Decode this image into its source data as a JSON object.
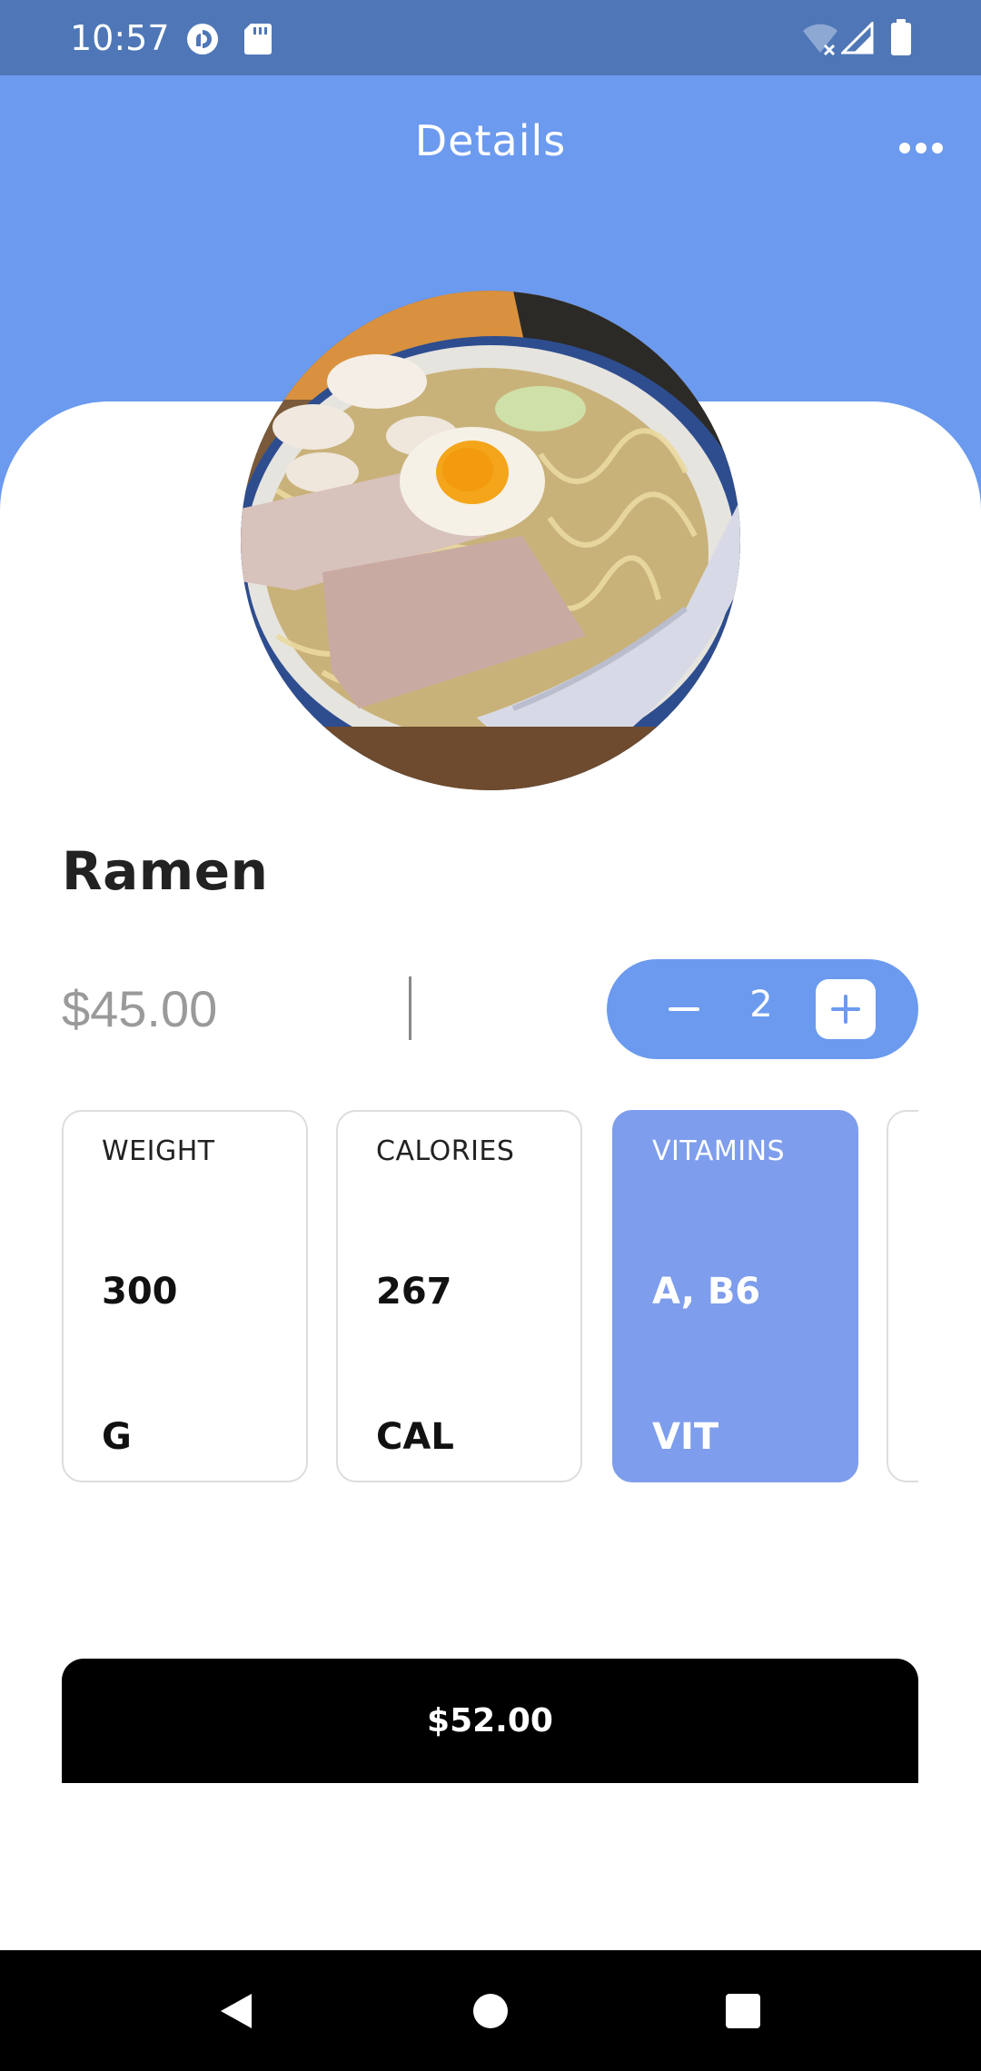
{
  "status_bar": {
    "time": "10:57",
    "icons": [
      "pocket-casts-icon",
      "sd-card-icon",
      "wifi-off-icon",
      "signal-icon",
      "battery-icon"
    ]
  },
  "app_bar": {
    "title": "Details",
    "menu_icon": "more-horizontal-icon"
  },
  "dish": {
    "name": "Ramen",
    "price": "$45.00",
    "image_subject": "bowl of ramen"
  },
  "quantity": {
    "value": "2",
    "decrement_icon": "minus-icon",
    "increment_icon": "plus-icon"
  },
  "nutrition": [
    {
      "label": "WEIGHT",
      "value": "300",
      "unit": "G",
      "active": false
    },
    {
      "label": "CALORIES",
      "value": "267",
      "unit": "CAL",
      "active": false
    },
    {
      "label": "VITAMINS",
      "value": "A, B6",
      "unit": "VIT",
      "active": true
    }
  ],
  "total_button": {
    "label": "$52.00"
  },
  "nav_bar": {
    "back_icon": "back-triangle-icon",
    "home_icon": "home-circle-icon",
    "recents_icon": "recents-square-icon"
  },
  "colors": {
    "header_blue": "#6b9aef",
    "status_blue": "#4f77b7",
    "active_card": "#7e9dec",
    "button_black": "#000000"
  }
}
